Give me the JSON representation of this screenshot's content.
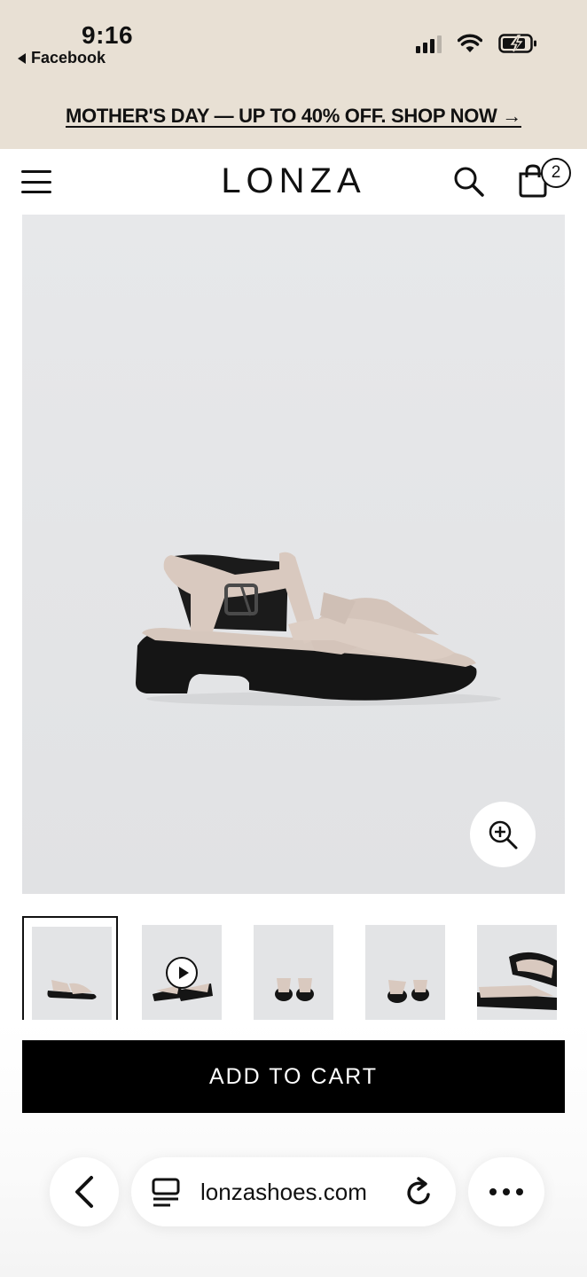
{
  "status_bar": {
    "time": "9:16",
    "back_app": "Facebook",
    "icons": [
      "signal-icon",
      "wifi-icon",
      "battery-charging-icon"
    ]
  },
  "promo": {
    "text": "MOTHER'S DAY — UP TO 40% OFF. SHOP NOW →"
  },
  "header": {
    "logo": "LONZA",
    "cart_count": "2",
    "icons": [
      "menu-icon",
      "search-icon",
      "shopping-bag-icon"
    ]
  },
  "gallery": {
    "active_index": 0,
    "thumbnails": [
      {
        "kind": "image",
        "view": "side"
      },
      {
        "kind": "video",
        "view": "pair"
      },
      {
        "kind": "image",
        "view": "front"
      },
      {
        "kind": "image",
        "view": "angled"
      },
      {
        "kind": "image",
        "view": "closeup"
      }
    ]
  },
  "actions": {
    "add_to_cart": "ADD TO CART"
  },
  "browser": {
    "url": "lonzashoes.com",
    "icons": [
      "chevron-left-icon",
      "reader-icon",
      "reload-icon",
      "more-icon"
    ]
  },
  "colors": {
    "promo_bg": "#e8e0d4",
    "product_bg": "#e5e6e8",
    "button_bg": "#000000",
    "sandal_leather": "#d9c9bf",
    "sole": "#141414"
  }
}
